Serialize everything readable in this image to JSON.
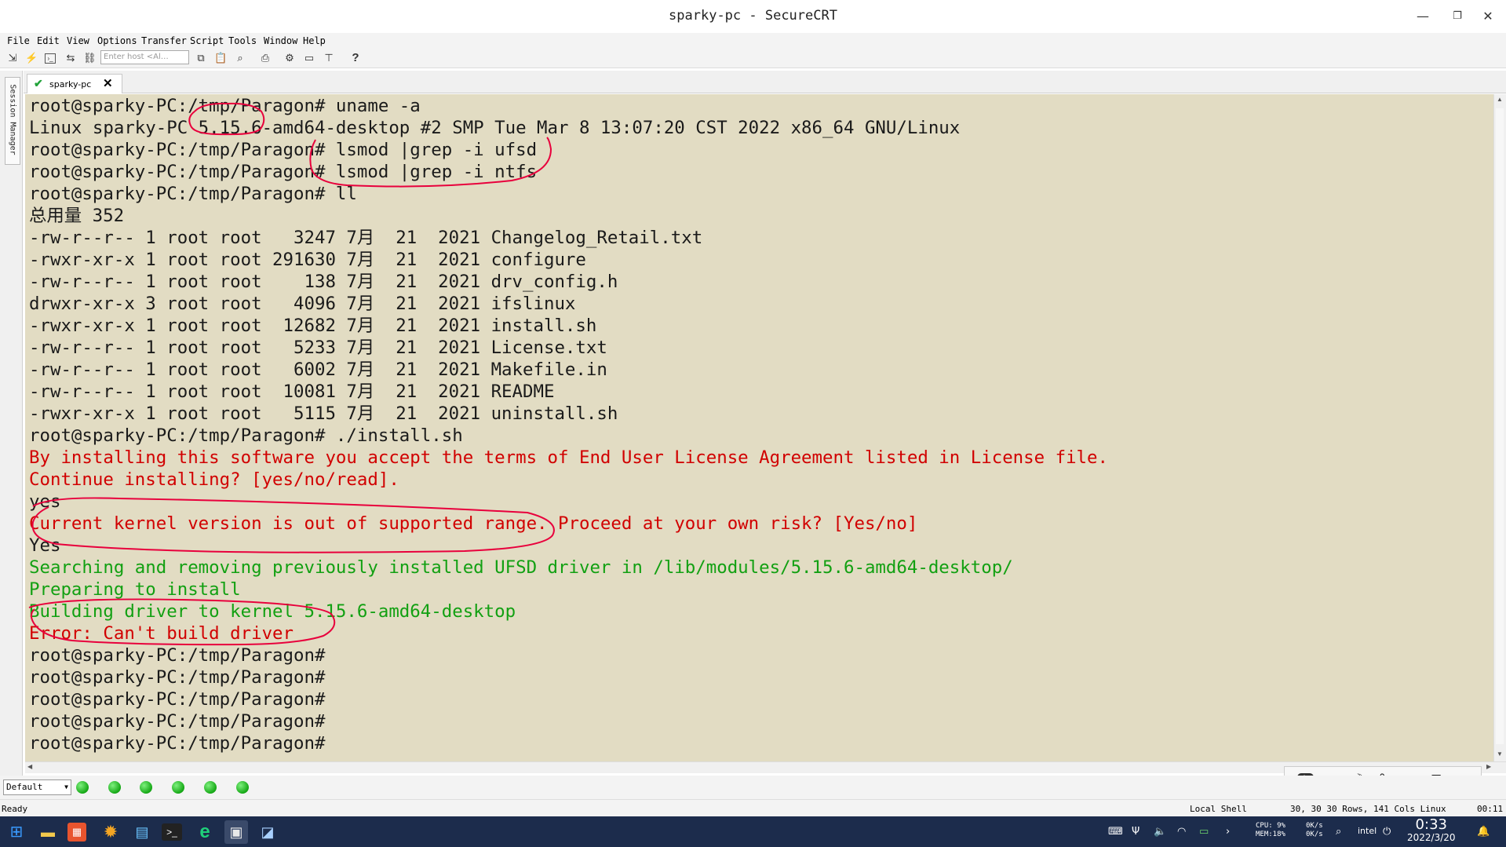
{
  "window": {
    "title": "sparky-pc - SecureCRT",
    "minimize": "—",
    "restore": "❐",
    "close": "✕"
  },
  "menu": [
    "File",
    "Edit",
    "View",
    "Options",
    "Transfer",
    "Script",
    "Tools",
    "Window",
    "Help"
  ],
  "toolbar": {
    "host_placeholder": "Enter host <Al…",
    "icons": [
      "connect-icon",
      "quick-connect-icon",
      "session-tab-icon",
      "reconnect-icon",
      "disconnect-icon",
      "copy-icon",
      "paste-icon",
      "find-icon",
      "print-icon",
      "settings-icon",
      "sftp-icon",
      "keymap-icon",
      "help-icon"
    ],
    "help_glyph": "?"
  },
  "session_manager": {
    "label": "Session Manager"
  },
  "tabs": [
    {
      "label": "sparky-pc",
      "status": "connected",
      "close": "✕"
    }
  ],
  "terminal": {
    "colors": {
      "background": "#e2dcc3",
      "default": "#1a1a1a",
      "red": "#d10000",
      "green": "#12a012",
      "annotation": "#e8003c"
    },
    "lines": [
      {
        "text": "root@sparky-PC:/tmp/Paragon# uname -a",
        "color": "default"
      },
      {
        "text": "Linux sparky-PC 5.15.6-amd64-desktop #2 SMP Tue Mar 8 13:07:20 CST 2022 x86_64 GNU/Linux",
        "color": "default"
      },
      {
        "text": "root@sparky-PC:/tmp/Paragon# lsmod |grep -i ufsd",
        "color": "default"
      },
      {
        "text": "root@sparky-PC:/tmp/Paragon# lsmod |grep -i ntfs",
        "color": "default"
      },
      {
        "text": "root@sparky-PC:/tmp/Paragon# ll",
        "color": "default"
      },
      {
        "text": "总用量 352",
        "color": "default"
      },
      {
        "text": "-rw-r--r-- 1 root root   3247 7月  21  2021 Changelog_Retail.txt",
        "color": "default"
      },
      {
        "text": "-rwxr-xr-x 1 root root 291630 7月  21  2021 configure",
        "color": "default"
      },
      {
        "text": "-rw-r--r-- 1 root root    138 7月  21  2021 drv_config.h",
        "color": "default"
      },
      {
        "text": "drwxr-xr-x 3 root root   4096 7月  21  2021 ifslinux",
        "color": "default"
      },
      {
        "text": "-rwxr-xr-x 1 root root  12682 7月  21  2021 install.sh",
        "color": "default"
      },
      {
        "text": "-rw-r--r-- 1 root root   5233 7月  21  2021 License.txt",
        "color": "default"
      },
      {
        "text": "-rw-r--r-- 1 root root   6002 7月  21  2021 Makefile.in",
        "color": "default"
      },
      {
        "text": "-rw-r--r-- 1 root root  10081 7月  21  2021 README",
        "color": "default"
      },
      {
        "text": "-rwxr-xr-x 1 root root   5115 7月  21  2021 uninstall.sh",
        "color": "default"
      },
      {
        "text": "root@sparky-PC:/tmp/Paragon# ./install.sh",
        "color": "default"
      },
      {
        "text": "By installing this software you accept the terms of End User License Agreement listed in License file.",
        "color": "red"
      },
      {
        "text": "Continue installing? [yes/no/read].",
        "color": "red"
      },
      {
        "text": "yes",
        "color": "default"
      },
      {
        "text": "Current kernel version is out of supported range. Proceed at your own risk? [Yes/no]",
        "color": "red"
      },
      {
        "text": "Yes",
        "color": "default"
      },
      {
        "text": "Searching and removing previously installed UFSD driver in /lib/modules/5.15.6-amd64-desktop/",
        "color": "green"
      },
      {
        "text": "Preparing to install",
        "color": "green"
      },
      {
        "text": "Building driver to kernel 5.15.6-amd64-desktop",
        "color": "green"
      },
      {
        "text": "Error: Can't build driver",
        "color": "red"
      },
      {
        "text": "root@sparky-PC:/tmp/Paragon#",
        "color": "default"
      },
      {
        "text": "root@sparky-PC:/tmp/Paragon#",
        "color": "default"
      },
      {
        "text": "root@sparky-PC:/tmp/Paragon#",
        "color": "default"
      },
      {
        "text": "root@sparky-PC:/tmp/Paragon#",
        "color": "default"
      },
      {
        "text": "root@sparky-PC:/tmp/Paragon#",
        "color": "default"
      }
    ]
  },
  "button_bar": {
    "selected": "Default",
    "buttons_count": 6
  },
  "ime": {
    "items": [
      "du",
      "中",
      "☽",
      "°,",
      "简",
      "⊞"
    ]
  },
  "status": {
    "left": "Ready",
    "shell": "Local Shell",
    "position": "30, 30 30 Rows, 141 Cols Linux",
    "time": "00:11"
  },
  "taskbar": {
    "apps": [
      "windows-start-icon",
      "file-explorer-icon",
      "store-icon",
      "settings-app-icon",
      "photos-icon",
      "terminal-icon",
      "edge-icon",
      "securecrt-icon",
      "app-icon"
    ],
    "cpu": "CPU: 9%",
    "mem": "MEM:18%",
    "net_up": "0K/s",
    "net_down": "0K/s",
    "clock_time": "0:33",
    "clock_date": "2022/3/20"
  }
}
